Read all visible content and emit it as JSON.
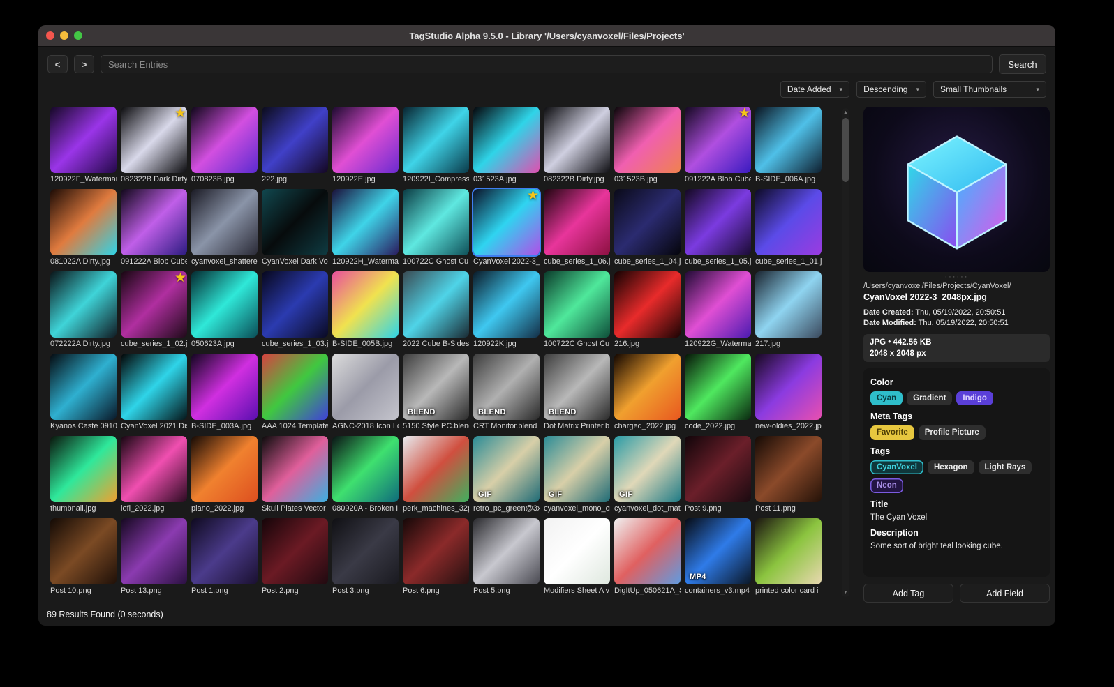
{
  "window": {
    "title": "TagStudio Alpha 9.5.0 - Library '/Users/cyanvoxel/Files/Projects'"
  },
  "toolbar": {
    "back": "<",
    "forward": ">",
    "search_placeholder": "Search Entries",
    "search_button": "Search"
  },
  "sort": {
    "field": "Date Added",
    "order": "Descending",
    "size": "Small Thumbnails"
  },
  "grid": {
    "items": [
      {
        "name": "120922F_Watermark",
        "colors": [
          "#150826",
          "#9a35e8",
          "#24094a"
        ]
      },
      {
        "name": "082322B Dark Dirty",
        "star": true,
        "colors": [
          "#0a0a0c",
          "#d9d9ea",
          "#0d0d10"
        ]
      },
      {
        "name": "070823B.jpg",
        "colors": [
          "#10071a",
          "#d24fe0",
          "#5b2bd0"
        ]
      },
      {
        "name": "222.jpg",
        "colors": [
          "#0b0b1a",
          "#4040c8",
          "#140722"
        ]
      },
      {
        "name": "120922E.jpg",
        "colors": [
          "#1e0a30",
          "#e04fd4",
          "#6b2bd0"
        ]
      },
      {
        "name": "120922I_Compress",
        "colors": [
          "#07222e",
          "#3fd4e8",
          "#0a3a4a"
        ]
      },
      {
        "name": "031523A.jpg",
        "colors": [
          "#05050a",
          "#2fd4e8",
          "#e04fb0"
        ]
      },
      {
        "name": "082322B Dirty.jpg",
        "colors": [
          "#0b0b0e",
          "#cfcfe0",
          "#101014"
        ]
      },
      {
        "name": "031523B.jpg",
        "colors": [
          "#090509",
          "#f05fb0",
          "#f0814f"
        ]
      },
      {
        "name": "091222A Blob Cube",
        "star": true,
        "colors": [
          "#140821",
          "#b04fe0",
          "#3a1bc0"
        ]
      },
      {
        "name": "B-SIDE_006A.jpg",
        "colors": [
          "#0a1420",
          "#4fc0e8",
          "#0f2030"
        ]
      },
      {
        "name": "081022A Dirty.jpg",
        "colors": [
          "#1c0b05",
          "#e07b3f",
          "#2fd4e8"
        ]
      },
      {
        "name": "091222A Blob Cube",
        "colors": [
          "#100719",
          "#c05fe8",
          "#2b1b80"
        ]
      },
      {
        "name": "cyanvoxel_shattere",
        "colors": [
          "#1a1a24",
          "#8a94a8",
          "#2a2a36"
        ]
      },
      {
        "name": "CyanVoxel Dark Vox",
        "colors": [
          "#11484f",
          "#070b0c",
          "#0f3b42"
        ]
      },
      {
        "name": "120922H_Waterma",
        "colors": [
          "#1a0f3a",
          "#3fd4e8",
          "#2a1b5e"
        ]
      },
      {
        "name": "100722C Ghost Cu",
        "colors": [
          "#0a3a42",
          "#5fe8e0",
          "#0e4f58"
        ]
      },
      {
        "name": "CyanVoxel 2022-3_",
        "star": true,
        "selected": true,
        "colors": [
          "#0a1228",
          "#2fd4f0",
          "#b04fe8"
        ]
      },
      {
        "name": "cube_series_1_06.j",
        "colors": [
          "#1f050f",
          "#e8359b",
          "#8b1040"
        ]
      },
      {
        "name": "cube_series_1_04.j",
        "colors": [
          "#0a0a18",
          "#2b2b70",
          "#05050b"
        ]
      },
      {
        "name": "cube_series_1_05.j",
        "colors": [
          "#120820",
          "#7b3be0",
          "#1a0b34"
        ]
      },
      {
        "name": "cube_series_1_01.j",
        "colors": [
          "#0d0a26",
          "#5b4be8",
          "#9b3be0"
        ]
      },
      {
        "name": "072222A Dirty.jpg",
        "colors": [
          "#0a1418",
          "#3fd4d8",
          "#101c24"
        ]
      },
      {
        "name": "cube_series_1_02.j",
        "star": true,
        "colors": [
          "#170610",
          "#b02fa0",
          "#1f0a19"
        ]
      },
      {
        "name": "050623A.jpg",
        "colors": [
          "#042a30",
          "#2fe8d8",
          "#0a4f58"
        ]
      },
      {
        "name": "cube_series_1_03.j",
        "colors": [
          "#07071c",
          "#2b3bb0",
          "#0a0a22"
        ]
      },
      {
        "name": "B-SIDE_005B.jpg",
        "colors": [
          "#e84f9b",
          "#f0e24f",
          "#2fd4e8"
        ]
      },
      {
        "name": "2022 Cube B-Sides",
        "colors": [
          "#3a4a52",
          "#4fd4e8",
          "#1a2a33"
        ]
      },
      {
        "name": "120922K.jpg",
        "colors": [
          "#0a1a28",
          "#3fc8f0",
          "#143048"
        ]
      },
      {
        "name": "100722C Ghost Cu",
        "colors": [
          "#0a3a2a",
          "#4fe89b",
          "#0e4f3a"
        ]
      },
      {
        "name": "216.jpg",
        "colors": [
          "#140202",
          "#e82b2b",
          "#1c0404"
        ]
      },
      {
        "name": "120922G_Waterma",
        "colors": [
          "#200a34",
          "#e04fd4",
          "#4b1bb0"
        ]
      },
      {
        "name": "217.jpg",
        "colors": [
          "#1a2430",
          "#8fd4f0",
          "#3b4a5e"
        ]
      },
      {
        "name": "Kyanos Caste 0910",
        "colors": [
          "#050a10",
          "#2fb0d0",
          "#0a1a2a"
        ]
      },
      {
        "name": "CyanVoxel 2021 Dis",
        "colors": [
          "#030303",
          "#2fd4e8",
          "#05161a"
        ]
      },
      {
        "name": "B-SIDE_003A.jpg",
        "colors": [
          "#120520",
          "#d02fe0",
          "#5b0fb0"
        ]
      },
      {
        "name": "AAA 1024 Template",
        "colors": [
          "#d84040",
          "#40c840",
          "#4040d8"
        ]
      },
      {
        "name": "AGNC-2018 Icon Lo",
        "colors": [
          "#dcdcdc",
          "#9b9ba8",
          "#c4c4cc"
        ]
      },
      {
        "name": "5150 Style PC.blend",
        "badge": "BLEND",
        "colors": [
          "#3c3c3c",
          "#b8b8b8",
          "#2b2b2b"
        ]
      },
      {
        "name": "CRT Monitor.blend",
        "badge": "BLEND",
        "colors": [
          "#3c3c3c",
          "#b0b0b0",
          "#2b2b2b"
        ]
      },
      {
        "name": "Dot Matrix Printer.b",
        "badge": "BLEND",
        "colors": [
          "#3c3c3c",
          "#b8b8b8",
          "#2b2b2b"
        ]
      },
      {
        "name": "charged_2022.jpg",
        "colors": [
          "#120600",
          "#f0a02f",
          "#e8581f"
        ]
      },
      {
        "name": "code_2022.jpg",
        "colors": [
          "#051206",
          "#4fe85f",
          "#0a2a10"
        ]
      },
      {
        "name": "new-oldies_2022.jp",
        "colors": [
          "#170821",
          "#8b3be0",
          "#e84fb0"
        ]
      },
      {
        "name": "thumbnail.jpg",
        "colors": [
          "#0a140b",
          "#2fe89b",
          "#f0a02f"
        ]
      },
      {
        "name": "lofi_2022.jpg",
        "colors": [
          "#150610",
          "#f04fb0",
          "#2a0a20"
        ]
      },
      {
        "name": "piano_2022.jpg",
        "colors": [
          "#150a05",
          "#f0812f",
          "#dd4f1f"
        ]
      },
      {
        "name": "Skull Plates Vector",
        "colors": [
          "#0b0b0b",
          "#e05f9b",
          "#3bb0e0"
        ]
      },
      {
        "name": "080920A - Broken I",
        "colors": [
          "#0a1214",
          "#3fe06f",
          "#0f6b7b"
        ]
      },
      {
        "name": "perk_machines_32p",
        "colors": [
          "#e8ecf0",
          "#d04f3f",
          "#3fb05f"
        ]
      },
      {
        "name": "retro_pc_green@3x",
        "badge": "GIF",
        "colors": [
          "#2a8b96",
          "#d8cfa8",
          "#1f6b76"
        ]
      },
      {
        "name": "cyanvoxel_mono_cr",
        "badge": "GIF",
        "colors": [
          "#2a8b96",
          "#d8cfa8",
          "#1f6b76"
        ]
      },
      {
        "name": "cyanvoxel_dot_mat",
        "badge": "GIF",
        "colors": [
          "#2a9ba6",
          "#e0d8b8",
          "#1f7b86"
        ]
      },
      {
        "name": "Post 9.png",
        "colors": [
          "#100509",
          "#6b1f2a",
          "#1a0a10"
        ]
      },
      {
        "name": "Post 11.png",
        "colors": [
          "#150a05",
          "#8b4a2a",
          "#241208"
        ]
      },
      {
        "name": "Post 10.png",
        "colors": [
          "#130a05",
          "#7b4a24",
          "#1f1008"
        ]
      },
      {
        "name": "Post 13.png",
        "colors": [
          "#150820",
          "#8b3bb0",
          "#2a1040"
        ]
      },
      {
        "name": "Post 1.png",
        "colors": [
          "#0f0a20",
          "#4b3b8b",
          "#1a1030"
        ]
      },
      {
        "name": "Post 2.png",
        "colors": [
          "#150509",
          "#6b1a24",
          "#200a10"
        ]
      },
      {
        "name": "Post 3.png",
        "colors": [
          "#101014",
          "#3a3a46",
          "#1a1a20"
        ]
      },
      {
        "name": "Post 6.png",
        "colors": [
          "#150808",
          "#8b2a2a",
          "#241010"
        ]
      },
      {
        "name": "Post 5.png",
        "colors": [
          "#2a2a2e",
          "#c8c8cf",
          "#4a4a52"
        ]
      },
      {
        "name": "Modifiers Sheet A v",
        "colors": [
          "#f2f2f2",
          "#ffffff",
          "#dfe8df"
        ]
      },
      {
        "name": "DigItUp_050621A_S",
        "colors": [
          "#f0f0f0",
          "#e06060",
          "#609be0"
        ]
      },
      {
        "name": "containers_v3.mp4",
        "badge": "MP4",
        "colors": [
          "#060a12",
          "#2f7be8",
          "#0a1626"
        ]
      },
      {
        "name": "printed color card i",
        "colors": [
          "#1b1510",
          "#8bc43f",
          "#e8d8b0"
        ]
      }
    ]
  },
  "preview": {
    "path": "/Users/cyanvoxel/Files/Projects/CyanVoxel/",
    "filename": "CyanVoxel 2022-3_2048px.jpg",
    "date_created_label": "Date Created:",
    "date_created": "Thu, 05/19/2022, 20:50:51",
    "date_modified_label": "Date Modified:",
    "date_modified": "Thu, 05/19/2022, 20:50:51",
    "file_type_line": "JPG • 442.56 KB",
    "dimensions": "2048 x 2048 px",
    "resize_dots": "······",
    "fields": {
      "color_label": "Color",
      "color_tags": [
        {
          "label": "Cyan",
          "style": "cyan"
        },
        {
          "label": "Gradient",
          "style": "plain"
        },
        {
          "label": "Indigo",
          "style": "indigo"
        }
      ],
      "meta_label": "Meta Tags",
      "meta_tags": [
        {
          "label": "Favorite",
          "style": "favorite"
        },
        {
          "label": "Profile Picture",
          "style": "plain"
        }
      ],
      "tags_label": "Tags",
      "tags": [
        {
          "label": "CyanVoxel",
          "style": "cyan-outline"
        },
        {
          "label": "Hexagon",
          "style": "plain"
        },
        {
          "label": "Light Rays",
          "style": "plain"
        },
        {
          "label": "Neon",
          "style": "neon"
        }
      ],
      "title_label": "Title",
      "title": "The Cyan Voxel",
      "description_label": "Description",
      "description": "Some sort of bright teal looking cube."
    },
    "add_tag": "Add Tag",
    "add_field": "Add Field"
  },
  "status": "89 Results Found (0 seconds)"
}
